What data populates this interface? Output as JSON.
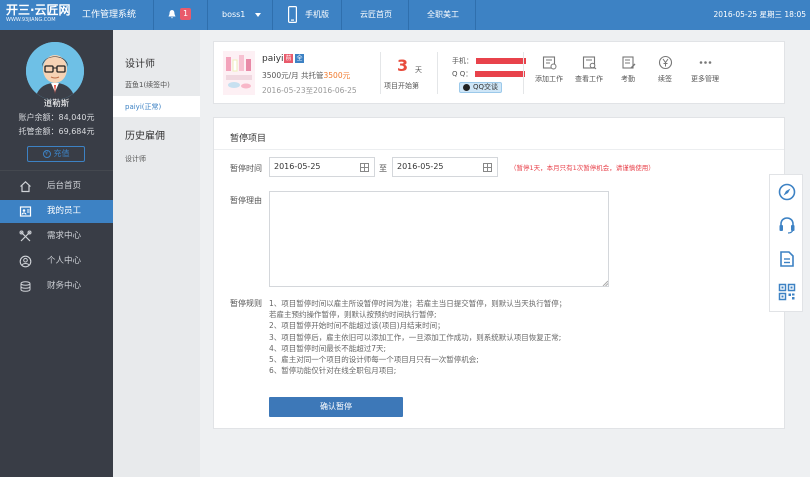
{
  "header": {
    "logo_text": "开三·云匠网",
    "logo_sub": "WWW.93JIANG.COM",
    "system_name": "工作管理系统",
    "notification_count": "1",
    "user_menu": "boss1",
    "nav_mobile": "手机版",
    "nav_home": "云匠首页",
    "nav_fulltime": "全职美工",
    "datetime": "2016-05-25 星期三 18:05"
  },
  "sidebar": {
    "user_name": "道勒斯",
    "balance": "账户余额：84,040元",
    "escrow": "托管金额：69,684元",
    "recharge_label": "充值",
    "items": [
      {
        "label": "后台首页",
        "icon": "home-icon"
      },
      {
        "label": "我的员工",
        "icon": "employee-icon"
      },
      {
        "label": "需求中心",
        "icon": "demand-icon"
      },
      {
        "label": "个人中心",
        "icon": "user-icon"
      },
      {
        "label": "财务中心",
        "icon": "finance-icon"
      }
    ]
  },
  "subnav": {
    "group1_title": "设计师",
    "group1_items": [
      "蓝鱼1(续签中)",
      "paiyi(正常)"
    ],
    "group2_title": "历史雇佣",
    "group2_items": [
      "设计师"
    ]
  },
  "project": {
    "name": "paiyi",
    "tag1": "前",
    "tag2": "全",
    "price_prefix": "3500元/月  共托管",
    "price_amount": "3500元",
    "date_range": "2016-05-23至2016-06-25",
    "days_number": "3",
    "days_unit": "天",
    "days_label": "项目开始第",
    "phone_label": "手机：",
    "qq_label": "Q Q：",
    "qq_button": "QQ交谈",
    "actions": [
      {
        "label": "添加工作",
        "icon": "add-work-icon"
      },
      {
        "label": "查看工作",
        "icon": "view-work-icon"
      },
      {
        "label": "考勤",
        "icon": "attendance-icon"
      },
      {
        "label": "续签",
        "icon": "renew-icon"
      },
      {
        "label": "更多管理",
        "icon": "more-icon"
      }
    ]
  },
  "pause_form": {
    "title": "暂停项目",
    "time_label": "暂停时间",
    "start_date": "2016-05-25",
    "to_label": "至",
    "end_date": "2016-05-25",
    "note": "（暂停1天，本月只有1次暂停机会，请谨慎使用）",
    "reason_label": "暂停理由",
    "reason_value": "",
    "rules_label": "暂停规则",
    "rules": [
      "1、项目暂停时间以雇主所设暂停时间为准；若雇主当日提交暂停，则默认当天执行暂停；",
      "若雇主预约操作暂停，则默认按预约时间执行暂停;",
      "2、项目暂停开始时间不能超过该(项目)月结束时间；",
      "3、项目暂停后，雇主依旧可以添加工作，一旦添加工作成功，则系统默认项目恢复正常;",
      "4、项目暂停时间最长不能超过7天;",
      "5、雇主对同一个项目的设计师每一个项目月只有一次暂停机会;",
      "6、暂停功能仅针对在线全职包月项目;"
    ],
    "confirm_label": "确认暂停"
  },
  "floatbar": {
    "icons": [
      "compass-icon",
      "headset-icon",
      "edit-note-icon",
      "qrcode-icon"
    ]
  },
  "colors": {
    "primary": "#3d82c4",
    "sidebar_bg": "#393d46",
    "alert_red": "#e8424b",
    "accent_orange": "#f07a2d"
  }
}
